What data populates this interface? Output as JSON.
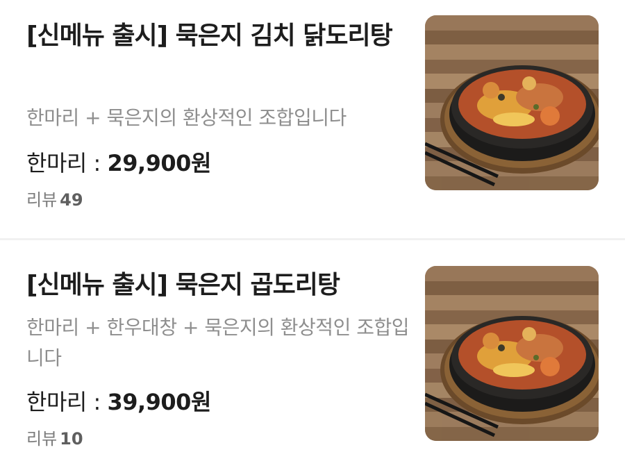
{
  "menu_items": [
    {
      "title": "[신메뉴 출시] 묵은지 김치 닭도리탕",
      "description": "한마리 + 묵은지의 환상적인 조합입니다",
      "price_label": "한마리 : ",
      "price_value": "29,900원",
      "review_label": "리뷰",
      "review_count": "49",
      "image": "kimchi-dakdoritang-photo"
    },
    {
      "title": "[신메뉴 출시] 묵은지 곱도리탕",
      "description": "한마리 + 한우대창 + 묵은지의 환상적인 조합입니다",
      "price_label": "한마리 : ",
      "price_value": "39,900원",
      "review_label": "리뷰",
      "review_count": "10",
      "image": "gopdoritang-photo"
    }
  ]
}
